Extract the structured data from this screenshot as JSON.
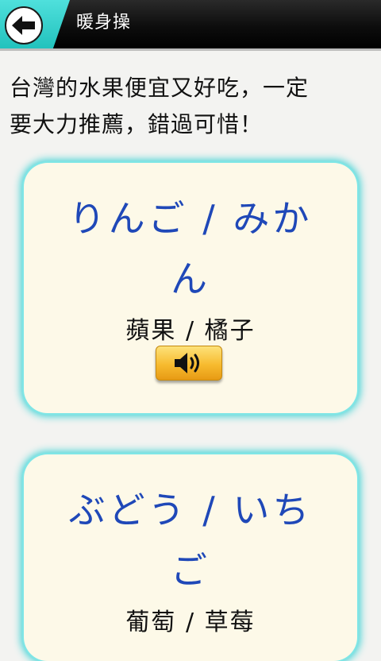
{
  "header": {
    "title": "暖身操",
    "back_icon": "arrow-left-icon"
  },
  "intro": {
    "line1": "台灣的水果便宜又好吃，一定",
    "line2": "要大力推薦，錯過可惜！"
  },
  "cards": [
    {
      "japanese_line1": "りんご / みか",
      "japanese_line2": "ん",
      "chinese": "蘋果 / 橘子",
      "audio_icon": "speaker-icon"
    },
    {
      "japanese_line1": "ぶどう / いち",
      "japanese_line2": "ご",
      "chinese": "葡萄 / 草莓"
    }
  ],
  "colors": {
    "accent": "#22c2bd",
    "japanese_text": "#1f48b8",
    "card_bg": "#fdf9e8",
    "audio_button": "#f7bb2f"
  }
}
